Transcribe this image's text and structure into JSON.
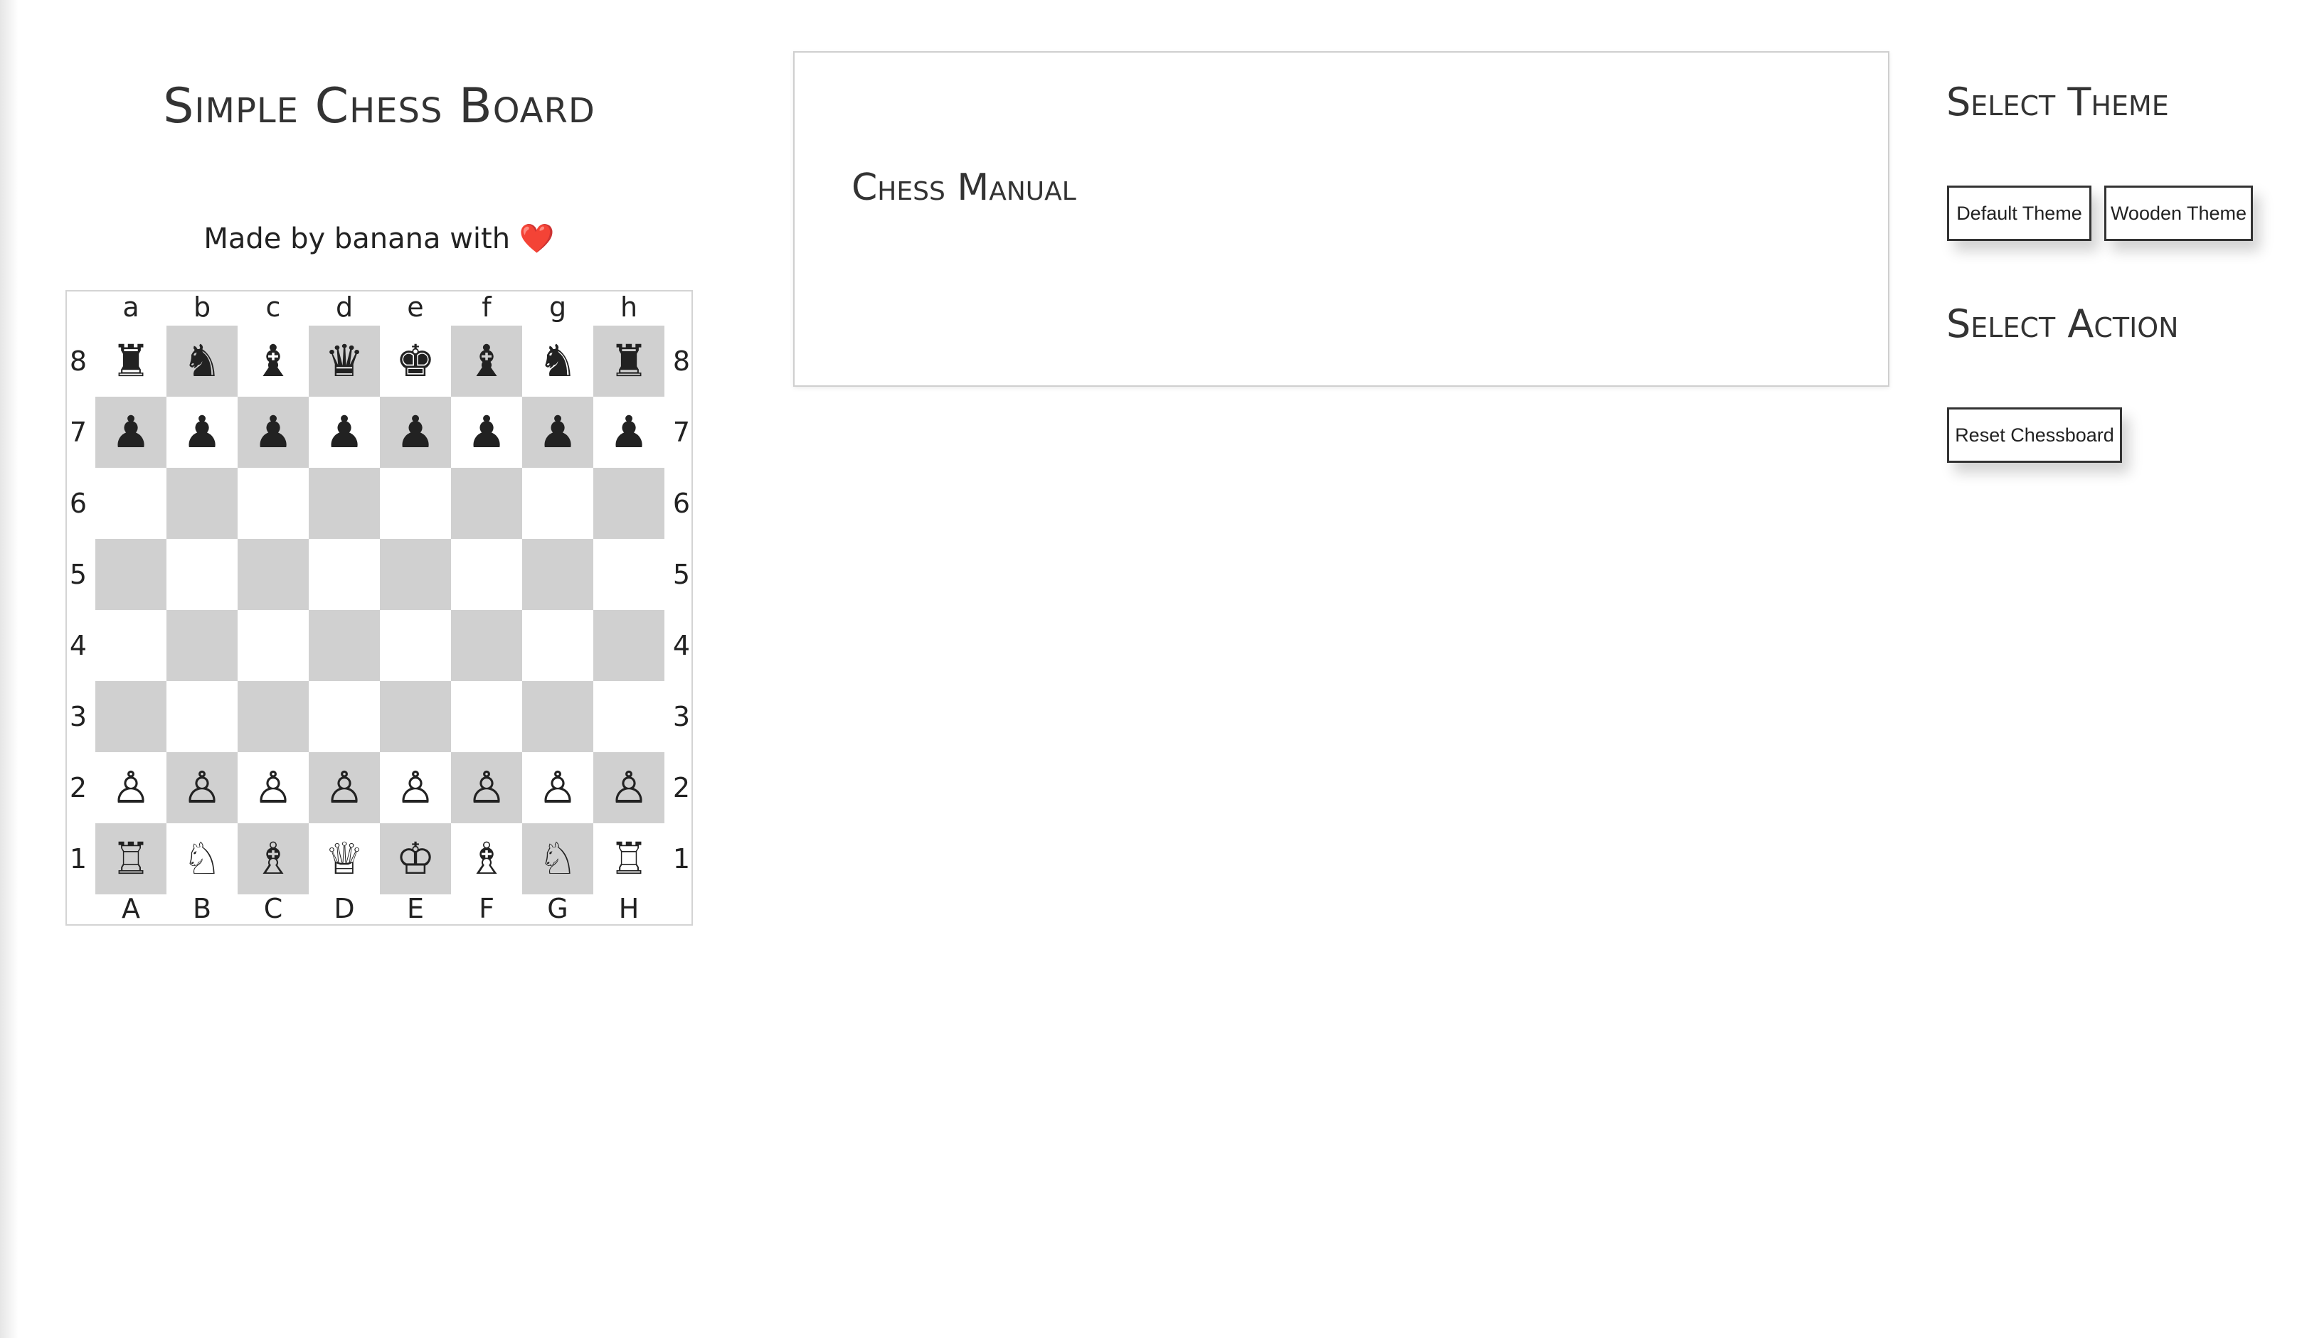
{
  "header": {
    "title": "Simple Chess Board",
    "credit_text": "Made by banana with",
    "credit_icon": "❤️"
  },
  "board": {
    "files_top": [
      "a",
      "b",
      "c",
      "d",
      "e",
      "f",
      "g",
      "h"
    ],
    "files_bottom": [
      "A",
      "B",
      "C",
      "D",
      "E",
      "F",
      "G",
      "H"
    ],
    "ranks": [
      "8",
      "7",
      "6",
      "5",
      "4",
      "3",
      "2",
      "1"
    ],
    "light_color": "#ffffff",
    "dark_color": "#d0d0d0",
    "squares": [
      [
        "♜",
        "♞",
        "♝",
        "♛",
        "♚",
        "♝",
        "♞",
        "♜"
      ],
      [
        "♟",
        "♟",
        "♟",
        "♟",
        "♟",
        "♟",
        "♟",
        "♟"
      ],
      [
        "",
        "",
        "",
        "",
        "",
        "",
        "",
        ""
      ],
      [
        "",
        "",
        "",
        "",
        "",
        "",
        "",
        ""
      ],
      [
        "",
        "",
        "",
        "",
        "",
        "",
        "",
        ""
      ],
      [
        "",
        "",
        "",
        "",
        "",
        "",
        "",
        ""
      ],
      [
        "♙",
        "♙",
        "♙",
        "♙",
        "♙",
        "♙",
        "♙",
        "♙"
      ],
      [
        "♖",
        "♘",
        "♗",
        "♕",
        "♔",
        "♗",
        "♘",
        "♖"
      ]
    ]
  },
  "manual": {
    "title": "Chess Manual"
  },
  "sidebar": {
    "theme_heading": "Select Theme",
    "theme_buttons": [
      "Default Theme",
      "Wooden Theme"
    ],
    "action_heading": "Select Action",
    "action_buttons": [
      "Reset Chessboard"
    ]
  }
}
